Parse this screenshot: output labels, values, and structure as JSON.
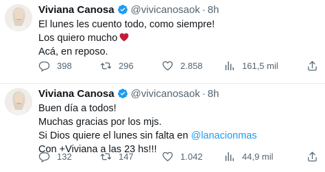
{
  "tweets": [
    {
      "name": "Viviana Canosa",
      "handle": "@vivicanosaok",
      "separator": "·",
      "time": "8h",
      "lines": [
        "El lunes les cuento todo, como siempre!",
        "Los quiero mucho",
        "Acá, en reposo."
      ],
      "heart_icon": "red-heart-emoji",
      "replies": "398",
      "retweets": "296",
      "likes": "2.858",
      "views": "161,5 mil"
    },
    {
      "name": "Viviana Canosa",
      "handle": "@vivicanosaok",
      "separator": "·",
      "time": "8h",
      "lines": [
        "Buen día a todos!",
        "Muchas gracias por los mjs.",
        "Si Dios quiere el lunes sin falta en",
        "Con +Viviana a las 23 hs!!!"
      ],
      "mention": "@lanacionmas",
      "replies": "132",
      "retweets": "147",
      "likes": "1.042",
      "views": "44,9 mil"
    }
  ],
  "colors": {
    "verified": "#1d9bf0",
    "text": "#0f1419",
    "muted": "#536471",
    "link": "#1d9bf0",
    "heart": "#c01e3a"
  }
}
